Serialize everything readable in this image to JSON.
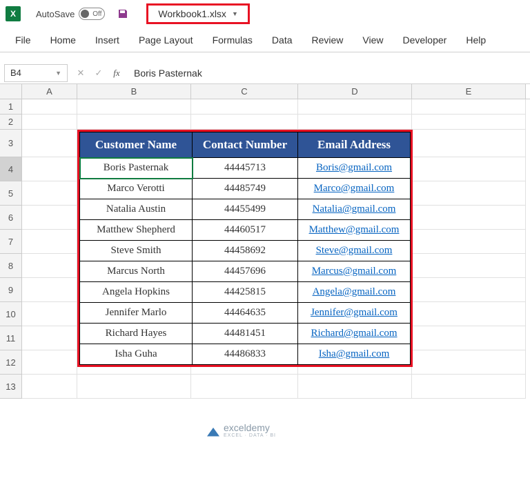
{
  "titlebar": {
    "autosave_label": "AutoSave",
    "autosave_state": "Off",
    "filename": "Workbook1.xlsx"
  },
  "ribbon": {
    "tabs": [
      "File",
      "Home",
      "Insert",
      "Page Layout",
      "Formulas",
      "Data",
      "Review",
      "View",
      "Developer",
      "Help"
    ]
  },
  "namebox": {
    "value": "B4"
  },
  "formula_bar": {
    "value": "Boris Pasternak"
  },
  "columns": [
    "A",
    "B",
    "C",
    "D",
    "E"
  ],
  "row_headers": [
    "1",
    "2",
    "3",
    "4",
    "5",
    "6",
    "7",
    "8",
    "9",
    "10",
    "11",
    "12",
    "13"
  ],
  "selected_row": "4",
  "table": {
    "headers": {
      "name": "Customer Name",
      "contact": "Contact Number",
      "email": "Email Address"
    },
    "rows": [
      {
        "name": "Boris Pasternak",
        "contact": "44445713",
        "email": "Boris@gmail.com"
      },
      {
        "name": "Marco Verotti",
        "contact": "44485749",
        "email": "Marco@gmail.com"
      },
      {
        "name": "Natalia Austin",
        "contact": "44455499",
        "email": "Natalia@gmail.com"
      },
      {
        "name": "Matthew Shepherd",
        "contact": "44460517",
        "email": "Matthew@gmail.com"
      },
      {
        "name": "Steve Smith",
        "contact": "44458692",
        "email": "Steve@gmail.com"
      },
      {
        "name": "Marcus North",
        "contact": "44457696",
        "email": "Marcus@gmail.com"
      },
      {
        "name": "Angela Hopkins",
        "contact": "44425815",
        "email": "Angela@gmail.com"
      },
      {
        "name": "Jennifer Marlo",
        "contact": "44464635",
        "email": "Jennifer@gmail.com"
      },
      {
        "name": "Richard Hayes",
        "contact": "44481451",
        "email": "Richard@gmail.com"
      },
      {
        "name": "Isha Guha",
        "contact": "44486833",
        "email": "Isha@gmail.com"
      }
    ]
  },
  "logo": {
    "brand": "exceldemy",
    "tagline": "EXCEL · DATA · BI"
  }
}
